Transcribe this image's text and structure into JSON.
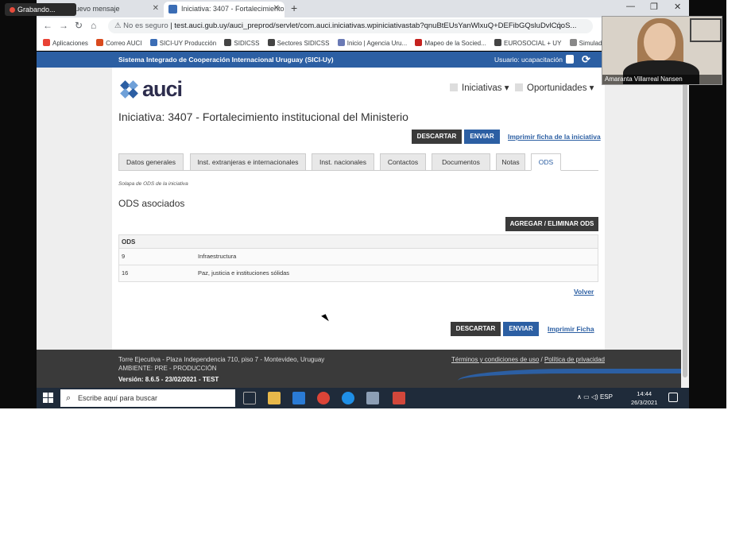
{
  "recording_label": "Grabando...",
  "tabs": [
    {
      "label": "Nuevo mensaje"
    },
    {
      "label": "Iniciativa: 3407 - Fortalecimiento"
    }
  ],
  "address": {
    "security": "No es seguro",
    "url": "test.auci.gub.uy/auci_preprod/servlet/com.auci.iniciativas.wpiniciativastab?qnuBtEUsYanWlxuQ+DEFibGQsluDvlCqoS..."
  },
  "bookmarks": [
    "Aplicaciones",
    "Correo AUCI",
    "SICI-UY Producción",
    "SIDICSS",
    "Sectores SIDICSS",
    "Inicio | Agencia Uru...",
    "Mapeo de la Socied...",
    "EUROSOCIAL + UY",
    "Simulador"
  ],
  "header": {
    "system_name": "Sistema Integrado de Cooperación Internacional Uruguay (SICI-Uy)",
    "user": "Usuario: ucapacitación"
  },
  "logo_text": "auci",
  "nav": {
    "iniciativas": "Iniciativas",
    "oportunidades": "Oportunidades"
  },
  "page_title": "Iniciativa: 3407 - Fortalecimiento institucional del Ministerio",
  "actions": {
    "discard": "DESCARTAR",
    "send": "ENVIAR",
    "print_link": "Imprimir ficha de la iniciativa",
    "print_short": "Imprimir Ficha",
    "add_remove": "AGREGAR / ELIMINAR ODS",
    "back": "Volver"
  },
  "page_tabs": [
    "Datos generales",
    "Inst. extranjeras e internacionales",
    "Inst. nacionales",
    "Contactos",
    "Documentos",
    "Notas",
    "ODS"
  ],
  "subtitle": "Solapa de ODS de la iniciativa",
  "section_title": "ODS asociados",
  "table": {
    "header": "ODS",
    "rows": [
      {
        "code": "9",
        "name": "Infraestructura"
      },
      {
        "code": "16",
        "name": "Paz, justicia e instituciones sólidas"
      }
    ]
  },
  "footer": {
    "address": "Torre Ejecutiva - Plaza Independencia 710, piso 7 - Montevideo, Uruguay",
    "env": "AMBIENTE: PRE - PRODUCCIÓN",
    "version": "Versión: 8.6.5 - 23/02/2021 - TEST",
    "terms": "Términos y condiciones de uso",
    "privacy": "Política de privacidad"
  },
  "taskbar": {
    "search_placeholder": "Escribe aquí para buscar",
    "lang": "ESP",
    "time": "14:44",
    "date": "26/3/2021"
  },
  "webcam_name": "Amaranta Villarreal Nansen"
}
